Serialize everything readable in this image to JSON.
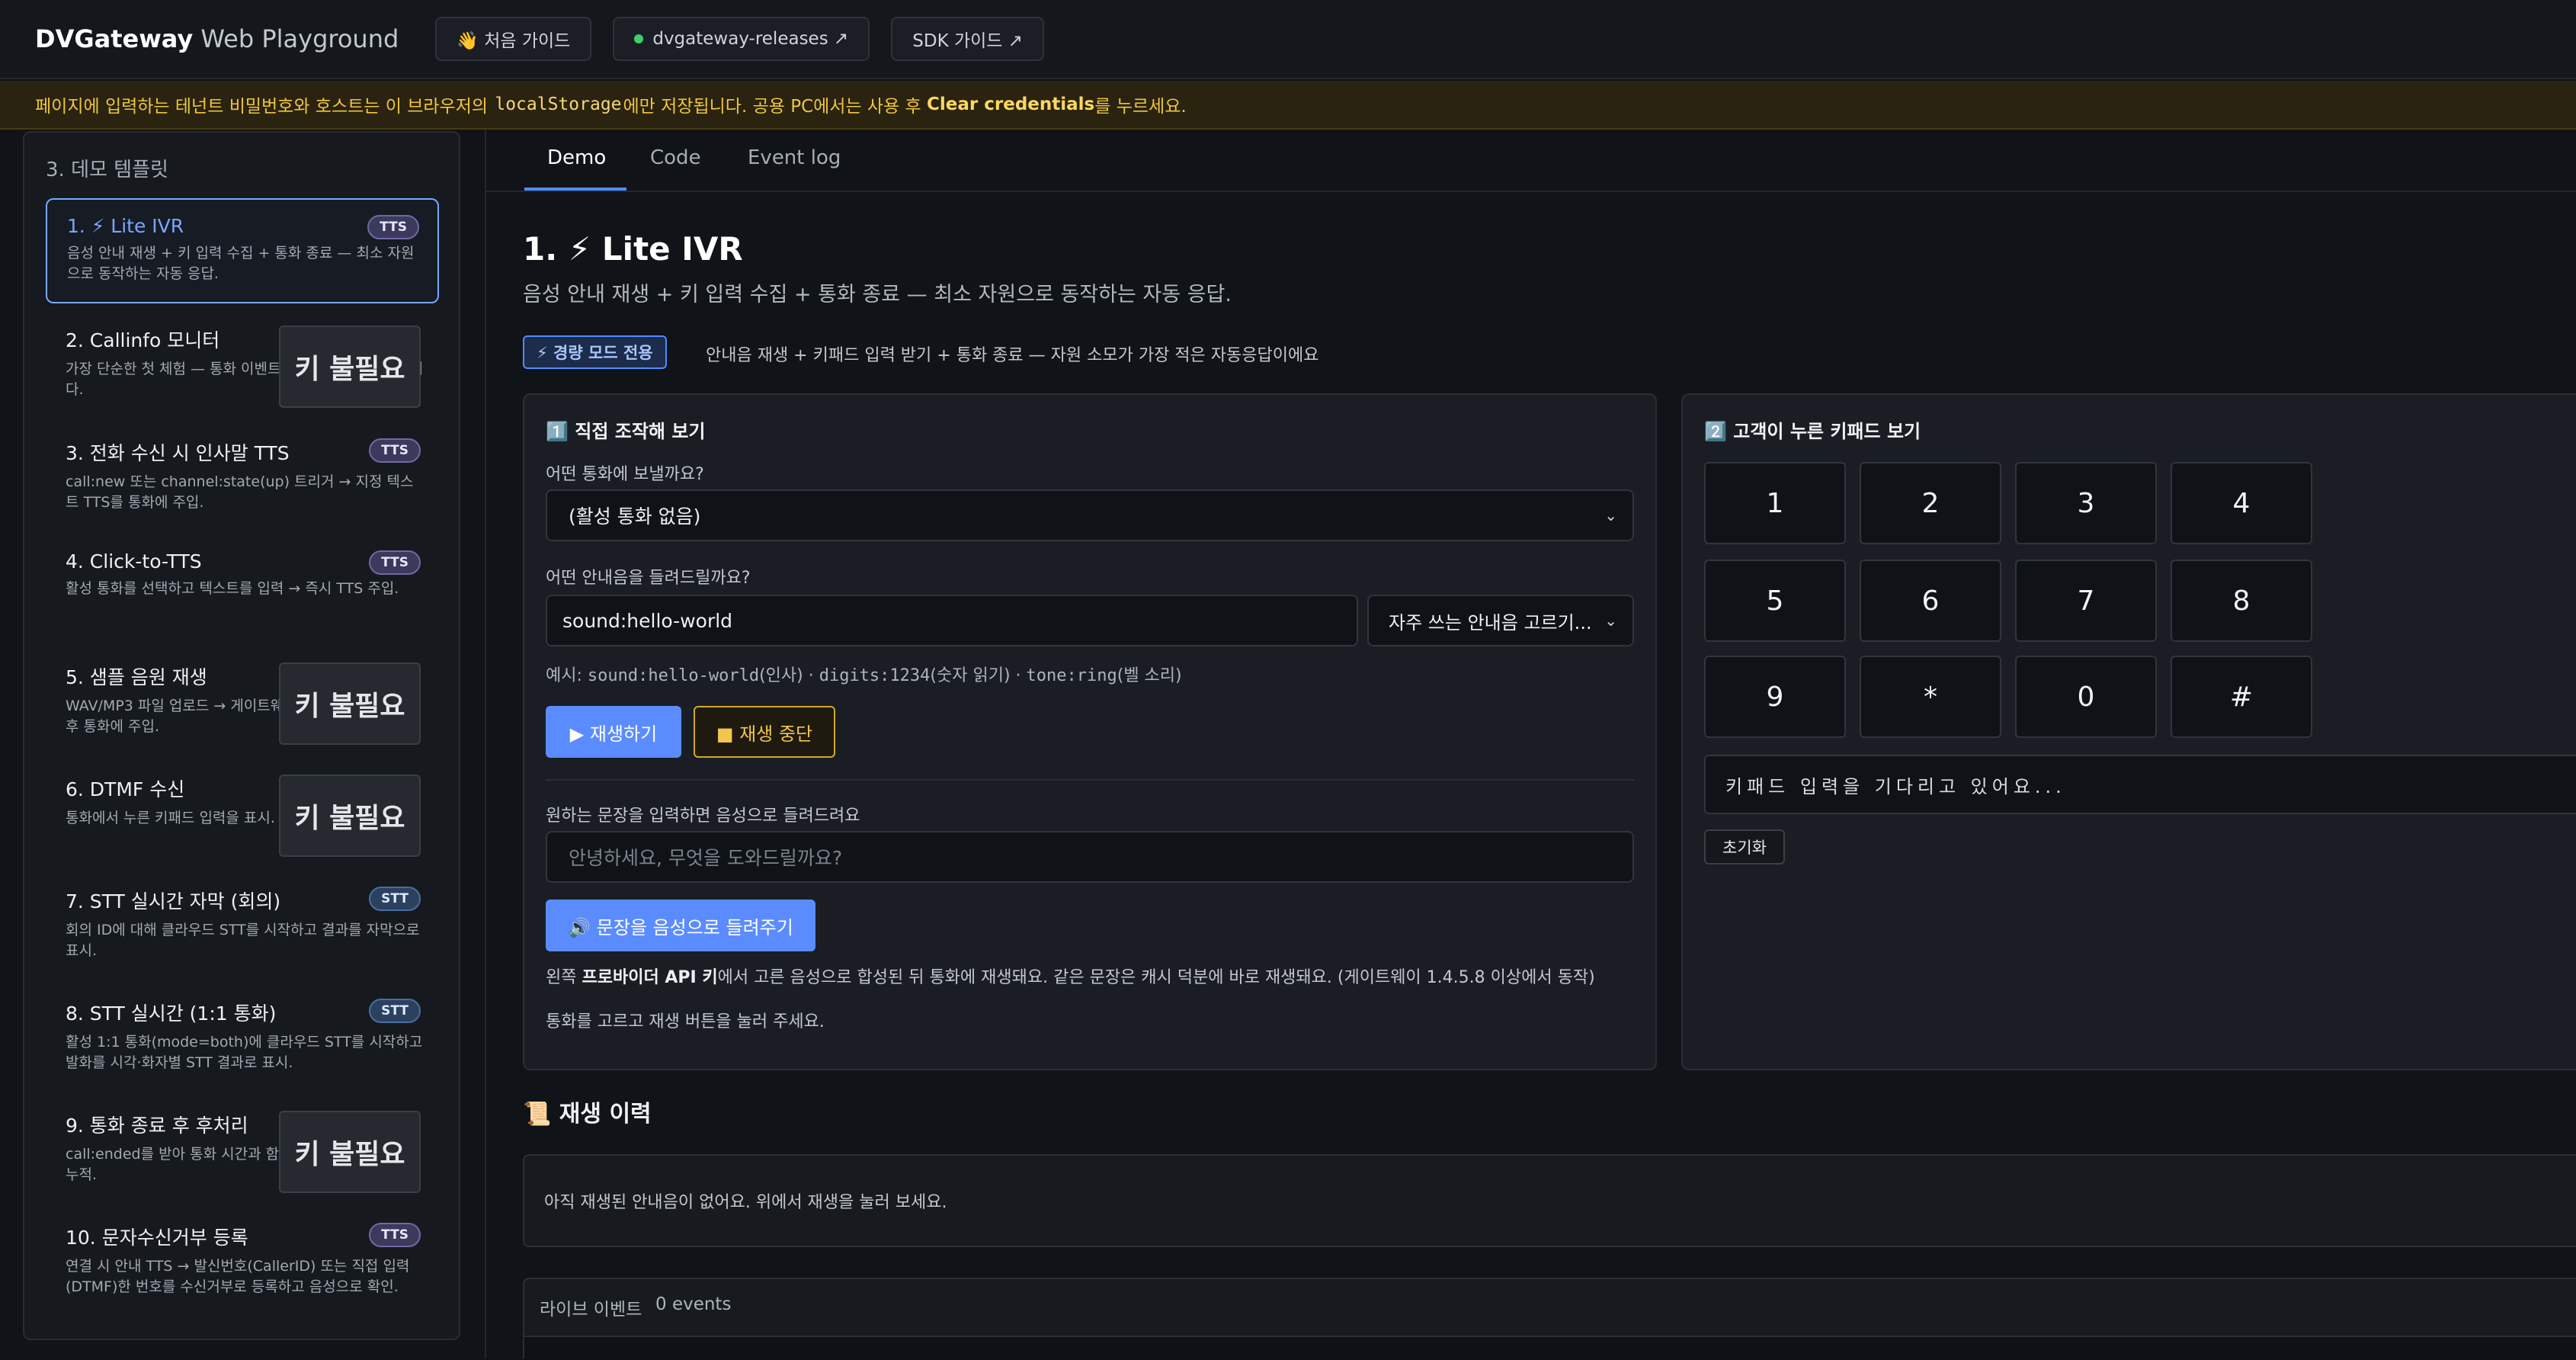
{
  "header": {
    "brand_bold": "DVGateway",
    "brand_rest": "Web Playground",
    "buttons": [
      {
        "label": "👋 처음 가이드"
      },
      {
        "label": "dvgateway-releases ↗"
      },
      {
        "label": "SDK 가이드 ↗"
      }
    ]
  },
  "warning": {
    "part1": "페이지에 입력하는 테넌트 비밀번호와 호스트는 이 브라우저의",
    "code": "localStorage",
    "part2": "에만 저장됩니다. 공용 PC에서는 사용 후",
    "bold": "Clear credentials",
    "part3": "를 누르세요."
  },
  "sidebar": {
    "title": "3. 데모 템플릿",
    "items": [
      {
        "title": "1. ⚡ Lite IVR",
        "badge": "TTS",
        "desc": "음성 안내 재생 + 키 입력 수집 + 통화 종료 — 최소 자원으로 동작하는 자동 응답."
      },
      {
        "title": "2. Callinfo 모니터",
        "badge": "키 불필요",
        "desc": "가장 단순한 첫 체험 — 통화 이벤트를 실시간으로 표시합니다."
      },
      {
        "title": "3. 전화 수신 시 인사말 TTS",
        "badge": "TTS",
        "desc": "call:new 또는 channel:state(up) 트리거 → 지정 텍스트 TTS를 통화에 주입."
      },
      {
        "title": "4. Click-to-TTS",
        "badge": "TTS",
        "desc": "활성 통화를 선택하고 텍스트를 입력 → 즉시 TTS 주입."
      },
      {
        "title": "5. 샘플 음원 재생",
        "badge": "키 불필요",
        "desc": "WAV/MP3 파일 업로드 → 게이트웨이가 ffmpeg로 변환 후 통화에 주입."
      },
      {
        "title": "6. DTMF 수신",
        "badge": "키 불필요",
        "desc": "통화에서 누른 키패드 입력을 표시. IVR 데모의 기본."
      },
      {
        "title": "7. STT 실시간 자막 (회의)",
        "badge": "STT",
        "desc": "회의 ID에 대해 클라우드 STT를 시작하고 결과를 자막으로 표시."
      },
      {
        "title": "8. STT 실시간 (1:1 통화)",
        "badge": "STT",
        "desc": "활성 1:1 통화(mode=both)에 클라우드 STT를 시작하고 발화를 시각·화자별 STT 결과로 표시."
      },
      {
        "title": "9. 통화 종료 후 후처리",
        "badge": "키 불필요",
        "desc": "call:ended를 받아 통화 시간과 함께 종료 이벤트 로그를 누적."
      },
      {
        "title": "10. 문자수신거부 등록",
        "badge": "TTS",
        "desc": "연결 시 안내 TTS → 발신번호(CallerID) 또는 직접 입력(DTMF)한 번호를 수신거부로 등록하고 음성으로 확인."
      }
    ]
  },
  "tabs": [
    "Demo",
    "Code",
    "Event log"
  ],
  "page": {
    "title": "1. ⚡ Lite IVR",
    "subtitle": "음성 안내 재생 + 키 입력 수집 + 통화 종료 — 최소 자원으로 동작하는 자동 응답.",
    "mode_badge": "⚡ 경량 모드 전용",
    "mode_desc": "안내음 재생 + 키패드 입력 받기 + 통화 종료 — 자원 소모가 가장 적은 자동응답이에요"
  },
  "control": {
    "title": "1️⃣ 직접 조작해 보기",
    "call_label": "어떤 통화에 보낼까요?",
    "call_value": "(활성 통화 없음)",
    "sound_label": "어떤 안내음을 들려드릴까요?",
    "sound_value": "sound:hello-world",
    "preset_value": "자주 쓰는 안내음 고르기...",
    "example_prefix": "예시: ",
    "example_1": "sound:hello-world",
    "example_1_note": "(인사) · ",
    "example_2": "digits:1234",
    "example_2_note": "(숫자 읽기) · ",
    "example_3": "tone:ring",
    "example_3_note": "(벨 소리)",
    "play_button": "▶ 재생하기",
    "stop_button": "■ 재생 중단",
    "tts_label": "원하는 문장을 입력하면 음성으로 들려드려요",
    "tts_placeholder": "안녕하세요, 무엇을 도와드릴까요?",
    "tts_button": "🔊 문장을 음성으로 들려주기",
    "note_prefix": "왼쪽 ",
    "note_bold": "프로바이더 API 키",
    "note_rest": "에서 고른 음성으로 합성된 뒤 통화에 재생돼요. 같은 문장은 캐시 덕분에 바로 재생돼요. (게이트웨이 1.4.5.8 이상에서 동작)",
    "status": "통화를 고르고 재생 버튼을 눌러 주세요."
  },
  "keypad": {
    "title": "2️⃣ 고객이 누른 키패드 보기",
    "keys": [
      "1",
      "2",
      "3",
      "4",
      "5",
      "6",
      "7",
      "8",
      "9",
      "*",
      "0",
      "#"
    ],
    "status": "키패드 입력을 기다리고 있어요...",
    "reset_button": "초기화"
  },
  "history": {
    "title": "📜 재생 이력",
    "empty": "아직 재생된 안내음이 없어요. 위에서 재생을 눌러 보세요."
  },
  "live": {
    "label": "라이브 이벤트",
    "count": "0 events"
  },
  "colors": {
    "accent": "#5b8cff",
    "warning": "#f0c53d",
    "background": "#101317"
  }
}
